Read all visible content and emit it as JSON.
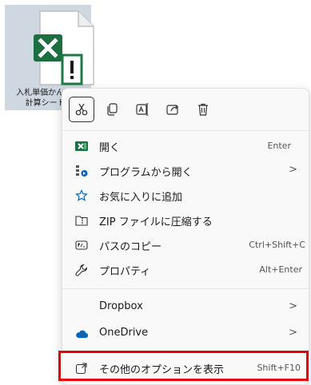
{
  "file": {
    "label_line1": "入札単価かんとく",
    "label_line2": "計算シートV",
    "icon": "excel-file-icon"
  },
  "toolbar": {
    "cut_icon": "scissors-icon",
    "copy_icon": "copy-icon",
    "rename_icon": "rename-icon",
    "share_icon": "share-icon",
    "delete_icon": "trash-icon"
  },
  "menu": {
    "items": [
      {
        "label": "開く",
        "shortcut": "Enter",
        "icon": "excel-icon"
      },
      {
        "label": "プログラムから開く",
        "shortcut": ">",
        "icon": "open-with-icon"
      },
      {
        "label": "お気に入りに追加",
        "shortcut": "",
        "icon": "star-icon"
      },
      {
        "label": "ZIP ファイルに圧縮する",
        "shortcut": "",
        "icon": "zip-folder-icon"
      },
      {
        "label": "パスのコピー",
        "shortcut": "Ctrl+Shift+C",
        "icon": "path-icon"
      },
      {
        "label": "プロパティ",
        "shortcut": "Alt+Enter",
        "icon": "wrench-icon"
      },
      {
        "label": "Dropbox",
        "shortcut": ">",
        "icon": ""
      },
      {
        "label": "OneDrive",
        "shortcut": ">",
        "icon": "cloud-icon"
      },
      {
        "label": "その他のオプションを表示",
        "shortcut": "Shift+F10",
        "icon": "more-options-icon"
      }
    ]
  },
  "colors": {
    "excel_green": "#1d6f42",
    "onedrive_blue": "#0364b8",
    "highlight_red": "#e8000b",
    "menu_bg": "#f9f9f9"
  }
}
